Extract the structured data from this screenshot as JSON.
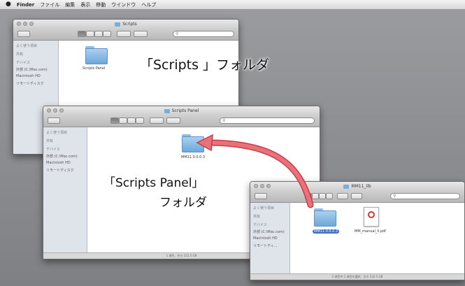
{
  "menubar": {
    "apple": "",
    "app": "Finder",
    "items": [
      "ファイル",
      "編集",
      "表示",
      "移動",
      "ウインドウ",
      "ヘルプ"
    ]
  },
  "windows": {
    "scripts": {
      "title": "Scripts",
      "sidebar": [
        "よく使う項目",
        "共有",
        "デバイス",
        "外部 (C:\\Mac.com)",
        "Macintosh HD",
        "リモートディスク"
      ],
      "folder_label": "Scripts Panel"
    },
    "scripts_panel": {
      "title": "Scripts Panel",
      "sidebar": [
        "よく使う項目",
        "共有",
        "デバイス",
        "外部 (C:\\Mac.com)",
        "Macintosh HD",
        "リモートディスク"
      ],
      "folder_label": "MM11.0.0.0.3",
      "status": "1 項目、空き 232.5 GB"
    },
    "download": {
      "title": "MM11_lib",
      "sidebar": [
        "よく使う項目",
        "共有",
        "デバイス",
        "外部 (C:\\Mac.com)",
        "Macintosh HD",
        "リモートディ..."
      ],
      "folder_label": "MM11.0.0.0.3",
      "file_label": "MM_manual_ll.pdf",
      "status": "2 項目中 1 項目を選択、空き 232.5 GB"
    }
  },
  "annotations": {
    "scripts_folder": "「Scripts 」フォルダ",
    "scripts_panel_line1": "「Scripts Panel」",
    "scripts_panel_line2": "フォルダ"
  },
  "colors": {
    "arrow": "#e8727a",
    "arrow_stroke": "#c83c46",
    "folder": "#7fb3e3",
    "selection": "#3f6fc4"
  }
}
